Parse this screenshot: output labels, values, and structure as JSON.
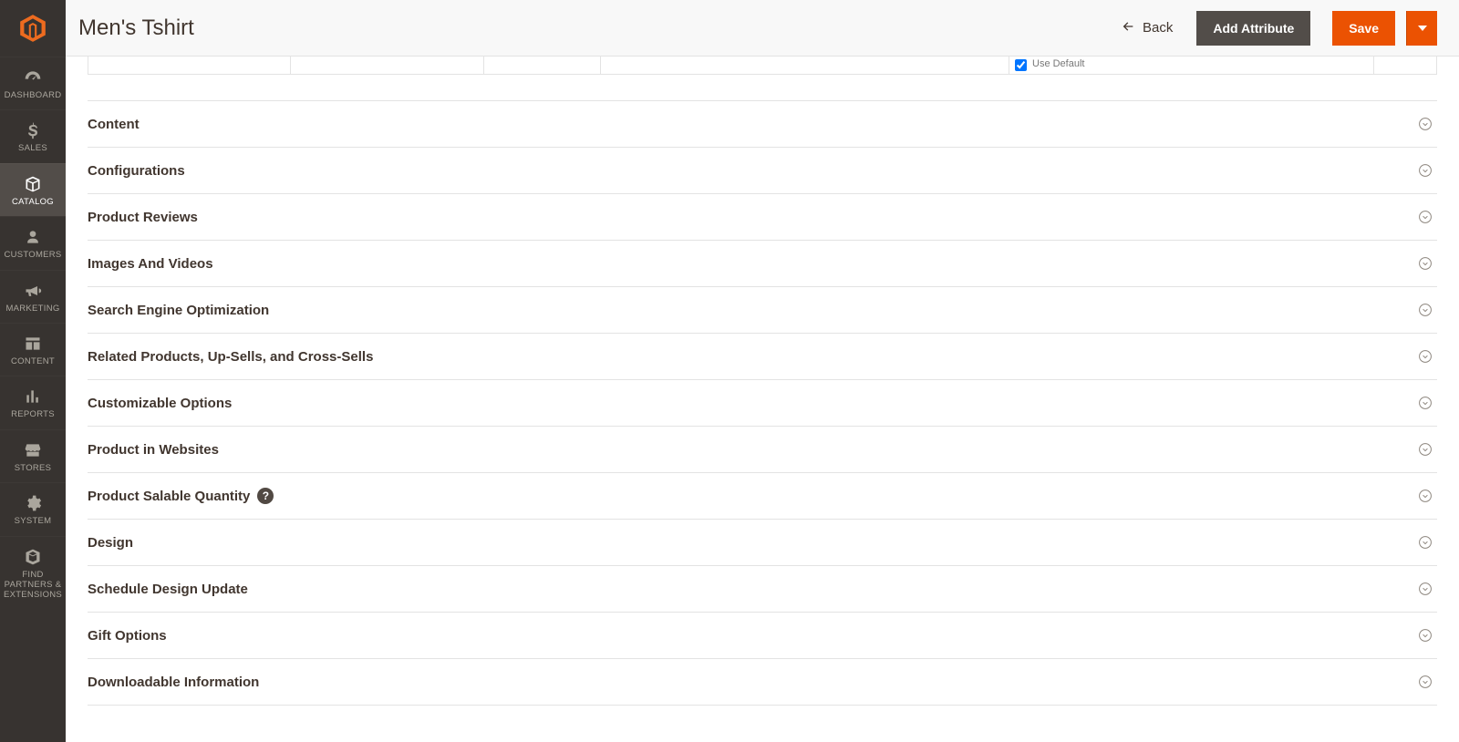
{
  "sidebar": {
    "items": [
      {
        "label": "DASHBOARD"
      },
      {
        "label": "SALES"
      },
      {
        "label": "CATALOG"
      },
      {
        "label": "CUSTOMERS"
      },
      {
        "label": "MARKETING"
      },
      {
        "label": "CONTENT"
      },
      {
        "label": "REPORTS"
      },
      {
        "label": "STORES"
      },
      {
        "label": "SYSTEM"
      },
      {
        "label": "FIND PARTNERS & EXTENSIONS"
      }
    ]
  },
  "header": {
    "title": "Men's Tshirt",
    "back": "Back",
    "add_attribute": "Add Attribute",
    "save": "Save"
  },
  "residual": {
    "use_default_label": "Use Default",
    "use_default_checked": true
  },
  "sections": [
    {
      "label": "Content",
      "help": false
    },
    {
      "label": "Configurations",
      "help": false
    },
    {
      "label": "Product Reviews",
      "help": false
    },
    {
      "label": "Images And Videos",
      "help": false
    },
    {
      "label": "Search Engine Optimization",
      "help": false
    },
    {
      "label": "Related Products, Up-Sells, and Cross-Sells",
      "help": false
    },
    {
      "label": "Customizable Options",
      "help": false
    },
    {
      "label": "Product in Websites",
      "help": false
    },
    {
      "label": "Product Salable Quantity",
      "help": true
    },
    {
      "label": "Design",
      "help": false
    },
    {
      "label": "Schedule Design Update",
      "help": false
    },
    {
      "label": "Gift Options",
      "help": false
    },
    {
      "label": "Downloadable Information",
      "help": false
    }
  ]
}
